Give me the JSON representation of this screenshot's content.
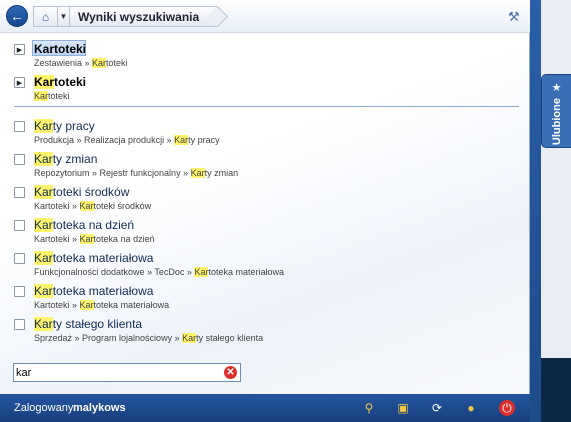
{
  "toolbar": {
    "title": "Wyniki wyszukiwania",
    "back_icon": "back-arrow-icon",
    "home_icon": "home-icon",
    "tool_icon": "tools-icon"
  },
  "sidebar_tab": {
    "label": "Ulubione",
    "icon": "star-icon"
  },
  "results_top": [
    {
      "t_hl": "Kartoteki",
      "t_rest": "",
      "path": [
        "Zestawienia » ",
        "Kar",
        "toteki"
      ]
    },
    {
      "t_hl": "Kar",
      "t_rest": "toteki",
      "path": [
        "",
        "Kar",
        "toteki"
      ]
    }
  ],
  "results": [
    {
      "t_hl": "Kar",
      "t_rest": "ty pracy",
      "path": [
        "Produkcja » Realizacja produkcji » ",
        "Kar",
        "ty pracy"
      ]
    },
    {
      "t_hl": "Kar",
      "t_rest": "ty zmian",
      "path": [
        "Repozytorium » Rejestr funkcjonalny » ",
        "Kar",
        "ty zmian"
      ]
    },
    {
      "t_hl": "Kar",
      "t_rest": "toteki środków",
      "path": [
        "Kartoteki » ",
        "Kar",
        "toteki środków"
      ]
    },
    {
      "t_hl": "Kar",
      "t_rest": "toteka na dzień",
      "path": [
        "Kartoteki » ",
        "Kar",
        "toteka na dzień"
      ]
    },
    {
      "t_hl": "Kar",
      "t_rest": "toteka materiałowa",
      "path": [
        "Funkcjonalności dodatkowe » TecDoc » ",
        "Kar",
        "toteka materiałowa"
      ]
    },
    {
      "t_hl": "Kar",
      "t_rest": "toteka materiałowa",
      "path": [
        "Kartoteki » ",
        "Kar",
        "toteka materiałowa"
      ]
    },
    {
      "t_hl": "Kar",
      "t_rest": "ty stałego klienta",
      "path": [
        "Sprzedaż » Program lojalnościowy » ",
        "Kar",
        "ty stałego klienta"
      ]
    }
  ],
  "search": {
    "value": "kar"
  },
  "status": {
    "label": "Zalogowany:",
    "user": "malykows",
    "icons": [
      "key-icon",
      "lock-icon",
      "refresh-icon",
      "user-lock-icon",
      "power-icon"
    ]
  },
  "colors": {
    "accent": "#1f4e8f",
    "highlight": "#fff36b"
  }
}
